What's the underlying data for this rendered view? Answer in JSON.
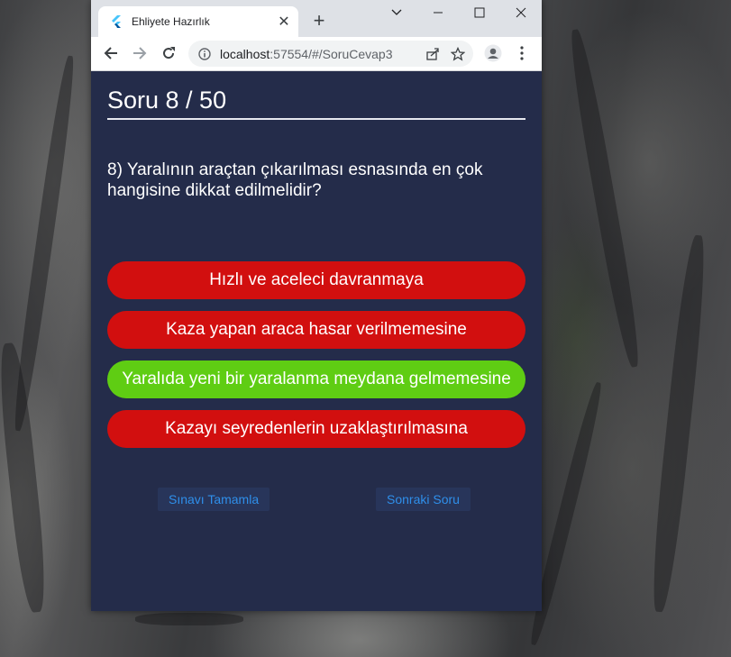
{
  "browser": {
    "tab_title": "Ehliyete Hazırlık",
    "url_host": "localhost",
    "url_rest": ":57554/#/SoruCevap3"
  },
  "quiz": {
    "progress_label": "Soru 8 / 50",
    "current": 8,
    "total": 50,
    "question": "8) Yaralının araçtan çıkarılması esnasında en çok hangisine dikkat edilmelidir?",
    "answers": [
      {
        "label": "Hızlı ve aceleci davranmaya",
        "state": "wrong",
        "color": "#d20f0f"
      },
      {
        "label": "Kaza yapan araca hasar verilmemesine",
        "state": "wrong",
        "color": "#d20f0f"
      },
      {
        "label": "Yaralıda yeni bir yaralanma meydana gelmemesine",
        "state": "correct",
        "color": "#5fcd13"
      },
      {
        "label": "Kazayı seyredenlerin uzaklaştırılmasına",
        "state": "wrong",
        "color": "#d20f0f"
      }
    ],
    "finish_label": "Sınavı Tamamla",
    "next_label": "Sonraki Soru"
  },
  "colors": {
    "app_background": "#242c4a",
    "accent_text": "#2f8fea"
  }
}
